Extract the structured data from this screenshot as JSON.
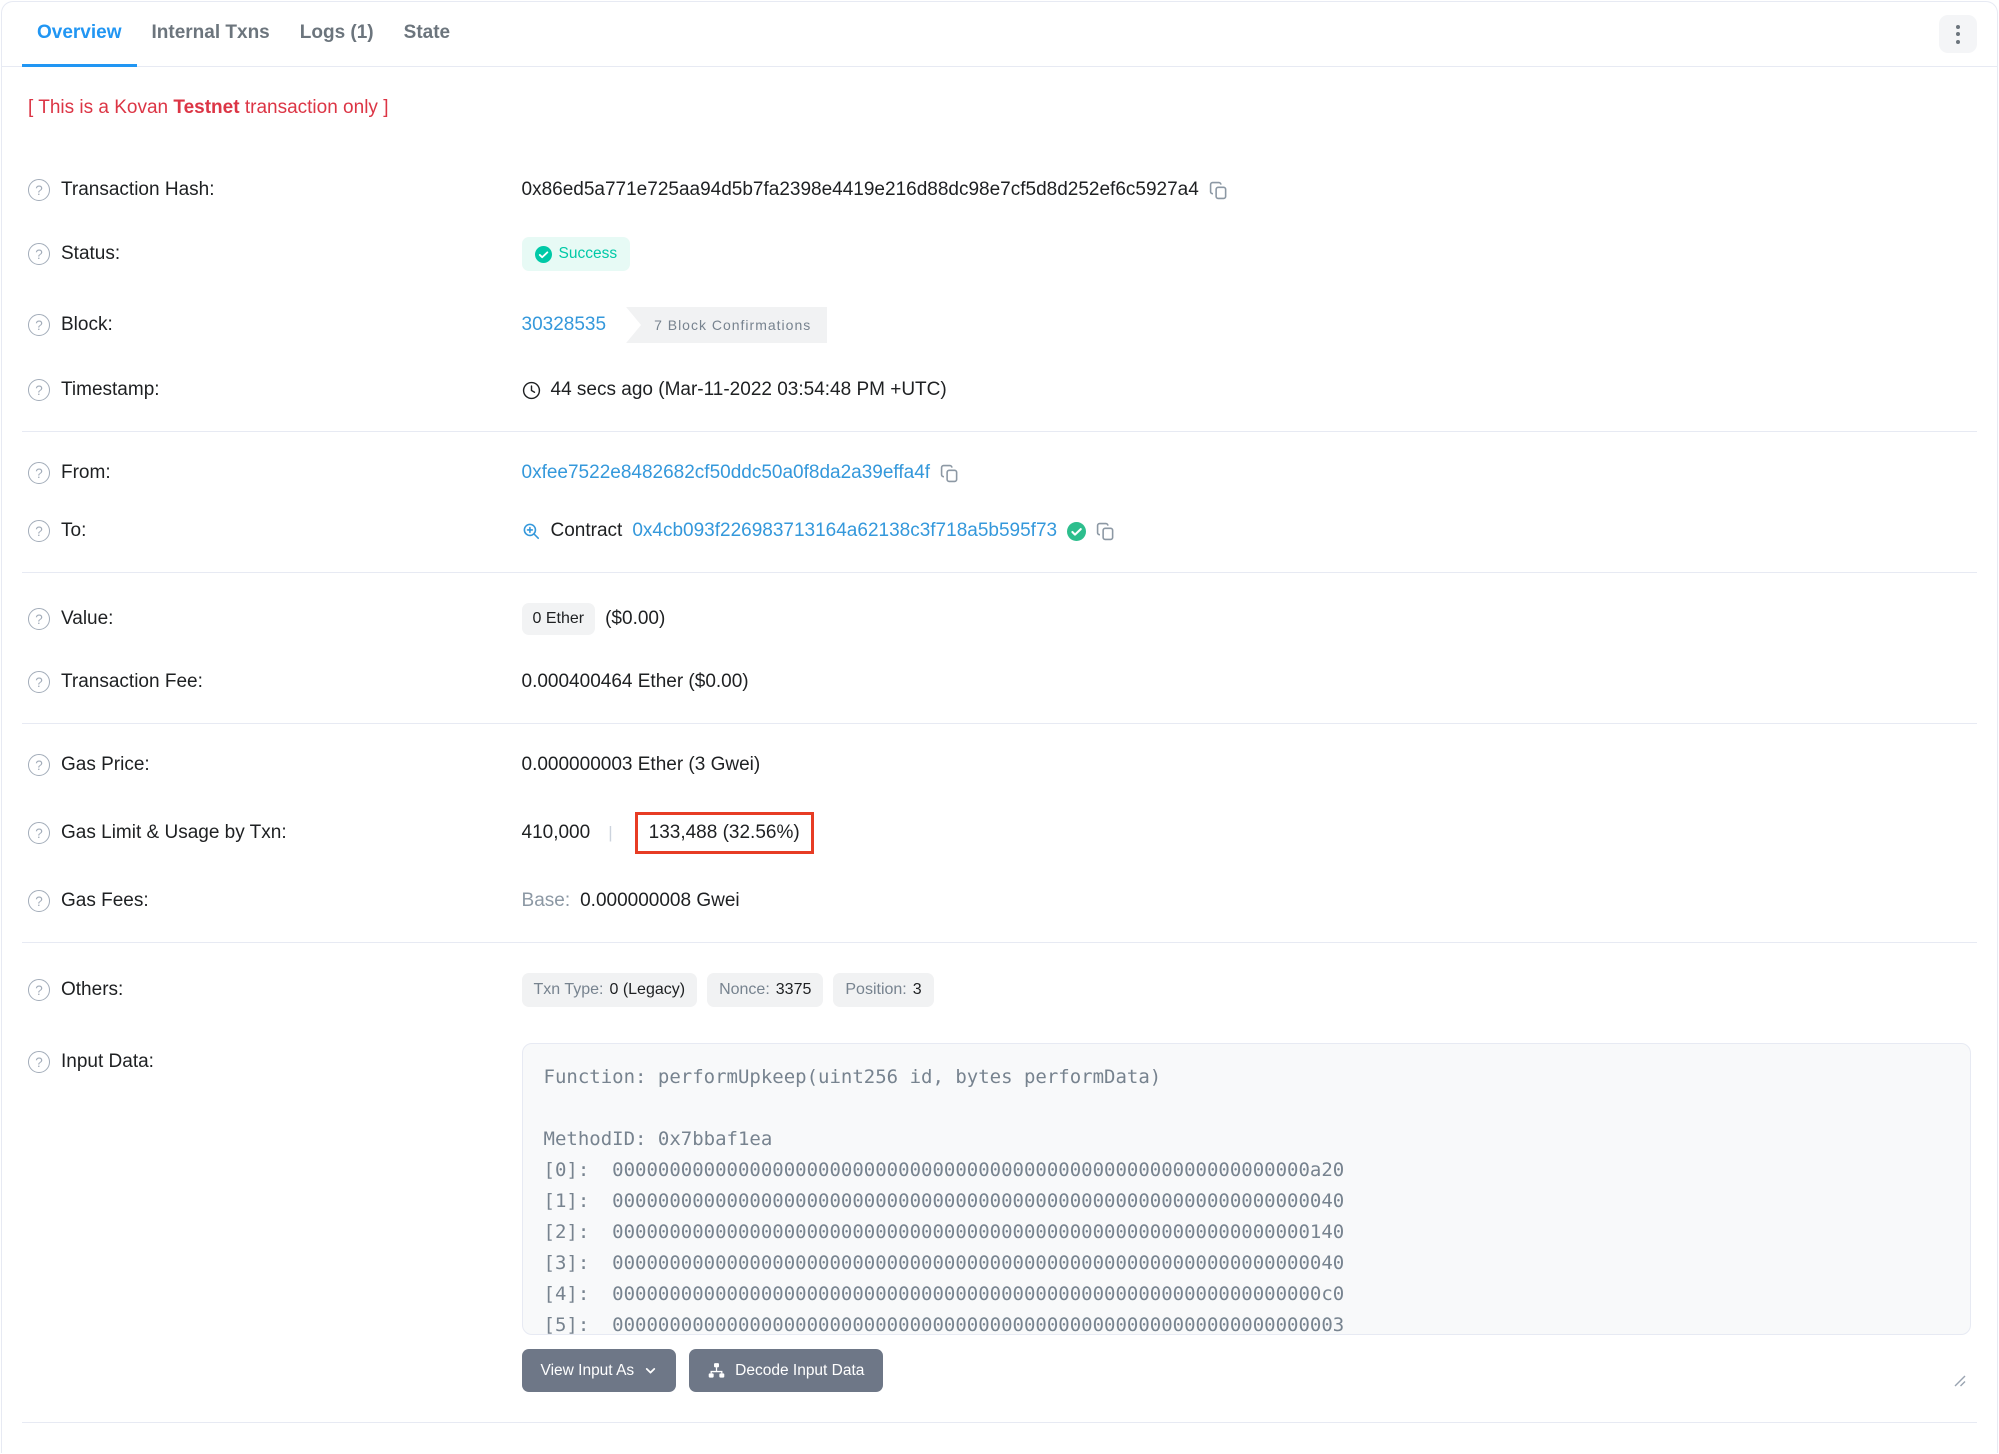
{
  "tabs": [
    {
      "label": "Overview",
      "active": true
    },
    {
      "label": "Internal Txns",
      "active": false
    },
    {
      "label": "Logs (1)",
      "active": false
    },
    {
      "label": "State",
      "active": false
    }
  ],
  "notice": {
    "prefix": "[ This is a Kovan ",
    "bold": "Testnet",
    "suffix": " transaction only ]"
  },
  "rows": {
    "hash": {
      "label": "Transaction Hash:",
      "value": "0x86ed5a771e725aa94d5b7fa2398e4419e216d88dc98e7cf5d8d252ef6c5927a4"
    },
    "status": {
      "label": "Status:",
      "badge": "Success"
    },
    "block": {
      "label": "Block:",
      "number": "30328535",
      "confirmations": "7 Block Confirmations"
    },
    "timestamp": {
      "label": "Timestamp:",
      "value": "44 secs ago (Mar-11-2022 03:54:48 PM +UTC)"
    },
    "from": {
      "label": "From:",
      "address": "0xfee7522e8482682cf50ddc50a0f8da2a39effa4f"
    },
    "to": {
      "label": "To:",
      "prefix": "Contract",
      "address": "0x4cb093f226983713164a62138c3f718a5b595f73"
    },
    "value": {
      "label": "Value:",
      "badge": "0 Ether",
      "usd": "($0.00)"
    },
    "fee": {
      "label": "Transaction Fee:",
      "value": "0.000400464 Ether ($0.00)"
    },
    "gas_price": {
      "label": "Gas Price:",
      "value": "0.000000003 Ether (3 Gwei)"
    },
    "gas_limit": {
      "label": "Gas Limit & Usage by Txn:",
      "limit": "410,000",
      "separator": "|",
      "used": "133,488 (32.56%)"
    },
    "gas_fees": {
      "label": "Gas Fees:",
      "base_label": "Base:",
      "base_value": "0.000000008 Gwei"
    },
    "others": {
      "label": "Others:",
      "txn_type_label": "Txn Type:",
      "txn_type_value": "0 (Legacy)",
      "nonce_label": "Nonce:",
      "nonce_value": "3375",
      "position_label": "Position:",
      "position_value": "3"
    },
    "input_data": {
      "label": "Input Data:",
      "raw": "Function: performUpkeep(uint256 id, bytes performData)\n\nMethodID: 0x7bbaf1ea\n[0]:  0000000000000000000000000000000000000000000000000000000000000a20\n[1]:  0000000000000000000000000000000000000000000000000000000000000040\n[2]:  0000000000000000000000000000000000000000000000000000000000000140\n[3]:  0000000000000000000000000000000000000000000000000000000000000040\n[4]:  00000000000000000000000000000000000000000000000000000000000000c0\n[5]:  0000000000000000000000000000000000000000000000000000000000000003",
      "view_input_as": "View Input As",
      "decode_button": "Decode Input Data"
    }
  },
  "colors": {
    "tab_blue": "#2196f3",
    "link_blue": "#3498db",
    "success_teal": "#00c9a7",
    "success_bg": "#e7faf5",
    "notice_red": "#dc3545",
    "highlight_red": "#e73c24",
    "btn_gray": "#6e7787"
  }
}
